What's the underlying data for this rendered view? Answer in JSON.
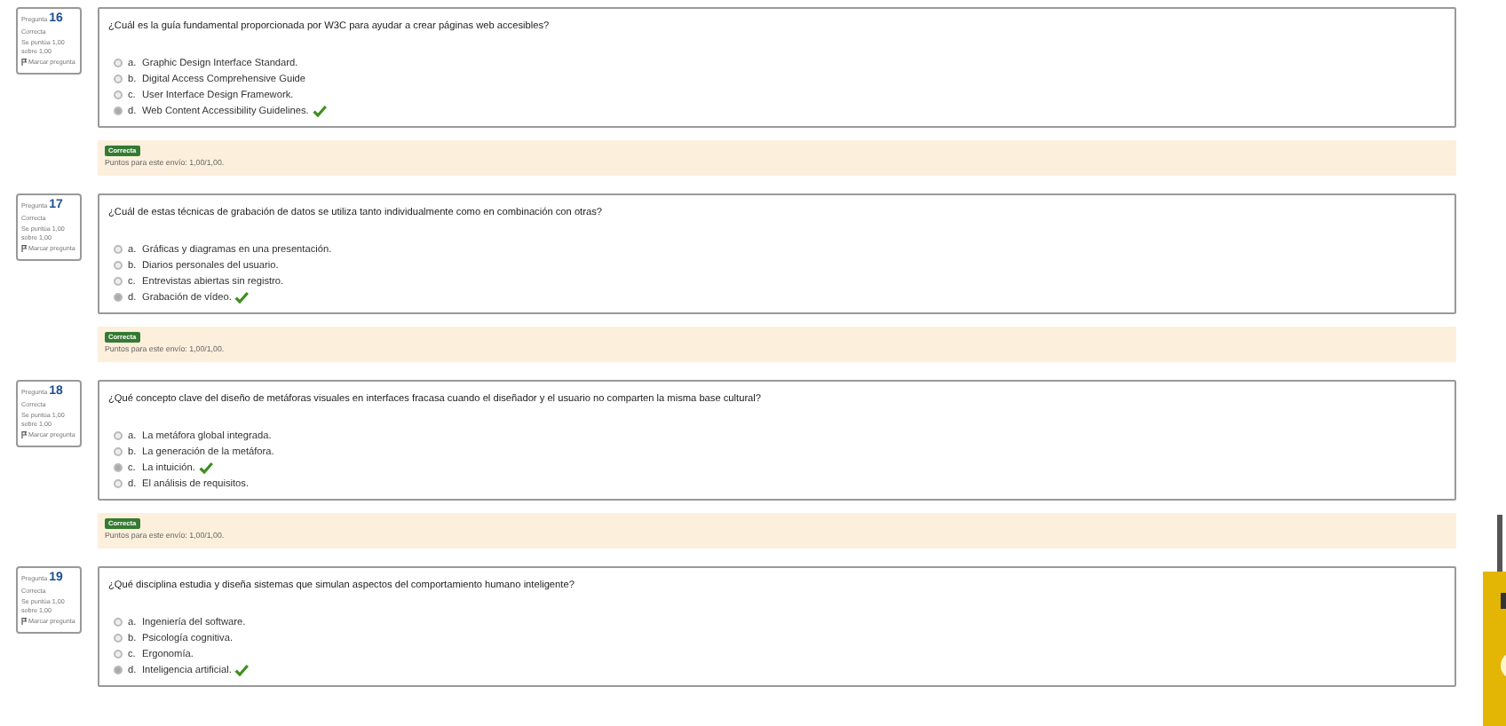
{
  "questions": [
    {
      "label": "Pregunta",
      "number": "16",
      "status": "Correcta",
      "score": "Se puntúa 1,00 sobre 1,00",
      "flag": "Marcar pregunta",
      "text": "¿Cuál es la guía fundamental proporcionada por W3C para ayudar a crear páginas web accesibles?",
      "options": [
        {
          "letter": "a.",
          "text": "Graphic Design Interface Standard.",
          "selected": false,
          "correct": false
        },
        {
          "letter": "b.",
          "text": "Digital Access Comprehensive Guide",
          "selected": false,
          "correct": false
        },
        {
          "letter": "c.",
          "text": "User Interface Design Framework.",
          "selected": false,
          "correct": false
        },
        {
          "letter": "d.",
          "text": "Web Content Accessibility Guidelines.",
          "selected": true,
          "correct": true
        }
      ],
      "feedback": {
        "badge": "Correcta",
        "text": "Puntos para este envío: 1,00/1,00."
      }
    },
    {
      "label": "Pregunta",
      "number": "17",
      "status": "Correcta",
      "score": "Se puntúa 1,00 sobre 1,00",
      "flag": "Marcar pregunta",
      "text": "¿Cuál de estas técnicas de grabación de datos se utiliza tanto individualmente como en combinación con otras?",
      "options": [
        {
          "letter": "a.",
          "text": "Gráficas y diagramas en una presentación.",
          "selected": false,
          "correct": false
        },
        {
          "letter": "b.",
          "text": "Diarios personales del usuario.",
          "selected": false,
          "correct": false
        },
        {
          "letter": "c.",
          "text": "Entrevistas abiertas sin registro.",
          "selected": false,
          "correct": false
        },
        {
          "letter": "d.",
          "text": "Grabación de vídeo.",
          "selected": true,
          "correct": true
        }
      ],
      "feedback": {
        "badge": "Correcta",
        "text": "Puntos para este envío: 1,00/1,00."
      }
    },
    {
      "label": "Pregunta",
      "number": "18",
      "status": "Correcta",
      "score": "Se puntúa 1,00 sobre 1,00",
      "flag": "Marcar pregunta",
      "text": "¿Qué concepto clave del diseño de metáforas visuales en interfaces fracasa cuando el diseñador y el usuario no comparten la misma base cultural?",
      "options": [
        {
          "letter": "a.",
          "text": "La metáfora global integrada.",
          "selected": false,
          "correct": false
        },
        {
          "letter": "b.",
          "text": "La generación de la metáfora.",
          "selected": false,
          "correct": false
        },
        {
          "letter": "c.",
          "text": "La intuición.",
          "selected": true,
          "correct": true
        },
        {
          "letter": "d.",
          "text": "El análisis de requisitos.",
          "selected": false,
          "correct": false
        }
      ],
      "feedback": {
        "badge": "Correcta",
        "text": "Puntos para este envío: 1,00/1,00."
      }
    },
    {
      "label": "Pregunta",
      "number": "19",
      "status": "Correcta",
      "score": "Se puntúa 1,00 sobre 1,00",
      "flag": "Marcar pregunta",
      "text": "¿Qué disciplina estudia y diseña sistemas que simulan aspectos del comportamiento humano inteligente?",
      "options": [
        {
          "letter": "a.",
          "text": "Ingeniería del software.",
          "selected": false,
          "correct": false
        },
        {
          "letter": "b.",
          "text": "Psicología cognitiva.",
          "selected": false,
          "correct": false
        },
        {
          "letter": "c.",
          "text": "Ergonomía.",
          "selected": false,
          "correct": false
        },
        {
          "letter": "d.",
          "text": "Inteligencia artificial.",
          "selected": true,
          "correct": true
        }
      ]
    }
  ]
}
